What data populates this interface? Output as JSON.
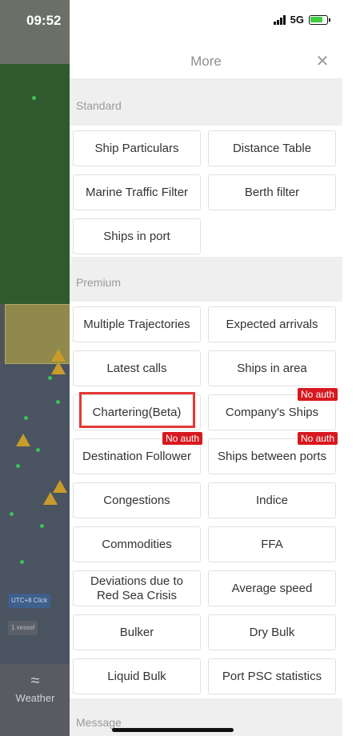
{
  "status_bar": {
    "time": "09:52",
    "network": "5G"
  },
  "map": {
    "chip1": "UTC+8 Click",
    "chip2": "1 vessel"
  },
  "left_tab": {
    "label": "Weather"
  },
  "panel": {
    "title": "More",
    "close_icon": "close-icon"
  },
  "sections": {
    "standard": "Standard",
    "premium": "Premium",
    "message": "Message"
  },
  "standard_items": [
    "Ship Particulars",
    "Distance Table",
    "Marine Traffic Filter",
    "Berth filter",
    "Ships in port"
  ],
  "premium_items": [
    "Multiple Trajectories",
    "Expected arrivals",
    "Latest calls",
    "Ships in area",
    "Chartering(Beta)",
    "Company's Ships",
    "Destination Follower",
    "Ships between ports",
    "Congestions",
    "Indice",
    "Commodities",
    "FFA",
    "Deviations due to Red Sea Crisis",
    "Average speed",
    "Bulker",
    "Dry Bulk",
    "Liquid Bulk",
    "Port PSC statistics"
  ],
  "badges": {
    "no_auth": "No auth"
  },
  "colors": {
    "badge": "#d7191f",
    "highlight": "#e53935",
    "map_dots": "#3fbf5a"
  }
}
